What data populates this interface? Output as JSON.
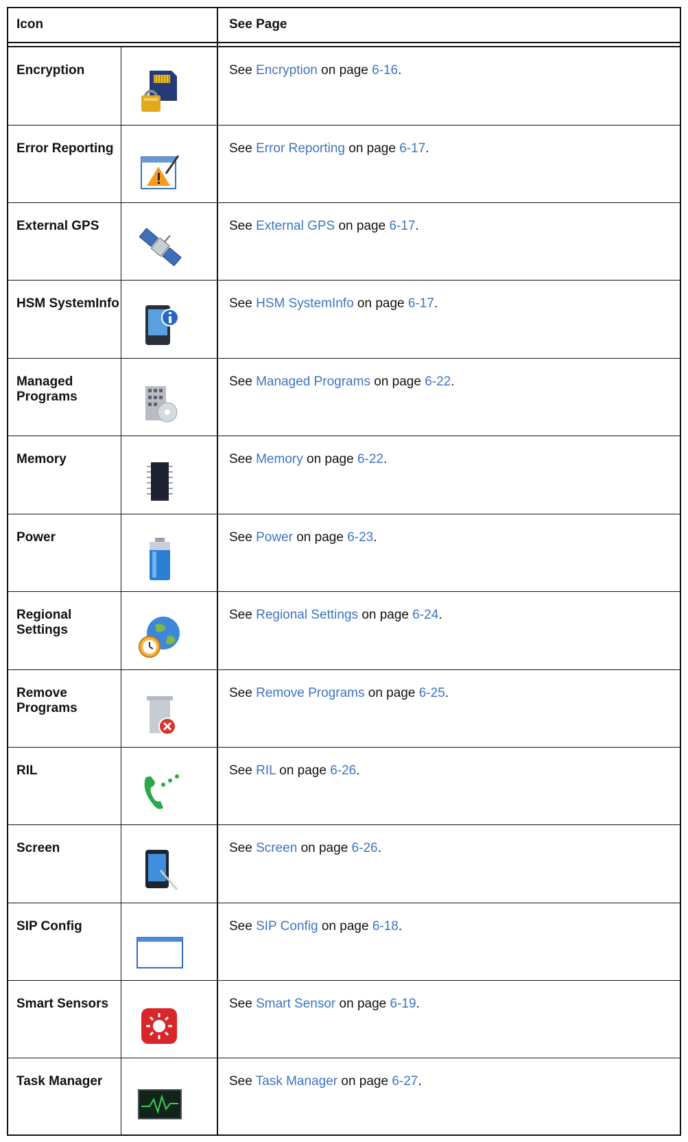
{
  "table": {
    "header": {
      "icon": "Icon",
      "see_page": "See Page"
    },
    "rows": [
      {
        "name": "Encryption",
        "icon": "sd-card-lock-icon",
        "see": "See",
        "link": "Encryption",
        "on_page": "on page",
        "page": "6-16",
        "end": "."
      },
      {
        "name": "Error Reporting",
        "icon": "error-report-icon",
        "see": "See",
        "link": "Error Reporting",
        "on_page": "on page",
        "page": "6-17",
        "end": "."
      },
      {
        "name": "External GPS",
        "icon": "satellite-icon",
        "see": "See",
        "link": "External GPS",
        "on_page": "on page",
        "page": "6-17",
        "end": "."
      },
      {
        "name": "HSM SystemInfo",
        "icon": "device-info-icon",
        "see": "See",
        "link": "HSM SystemInfo",
        "on_page": "on page",
        "page": "6-17",
        "end": "."
      },
      {
        "name": "Managed Programs",
        "icon": "building-disc-icon",
        "see": "See",
        "link": "Managed Programs",
        "on_page": "on page",
        "page": "6-22",
        "end": "."
      },
      {
        "name": "Memory",
        "icon": "memory-chip-icon",
        "see": "See",
        "link": "Memory",
        "on_page": "on page",
        "page": "6-22",
        "end": "."
      },
      {
        "name": "Power",
        "icon": "battery-icon",
        "see": "See",
        "link": "Power",
        "on_page": "on page",
        "page": "6-23",
        "end": "."
      },
      {
        "name": "Regional Settings",
        "icon": "globe-clock-icon",
        "see": "See",
        "link": "Regional Settings",
        "on_page": "on page",
        "page": "6-24",
        "end": "."
      },
      {
        "name": "Remove Programs",
        "icon": "trash-remove-icon",
        "see": "See",
        "link": "Remove Programs",
        "on_page": "on page",
        "page": "6-25",
        "end": "."
      },
      {
        "name": "RIL",
        "icon": "phone-signal-icon",
        "see": "See",
        "link": "RIL",
        "on_page": "on page",
        "page": "6-26",
        "end": "."
      },
      {
        "name": "Screen",
        "icon": "screen-stylus-icon",
        "see": "See",
        "link": "Screen",
        "on_page": "on page",
        "page": "6-26",
        "end": "."
      },
      {
        "name": "SIP Config",
        "icon": "window-icon",
        "see": "See",
        "link": "SIP Config",
        "on_page": "on page",
        "page": "6-18",
        "end": "."
      },
      {
        "name": "Smart Sensors",
        "icon": "smart-sensor-icon",
        "see": "See",
        "link": "Smart Sensor",
        "on_page": "on page",
        "page": "6-19",
        "end": "."
      },
      {
        "name": "Task Manager",
        "icon": "task-monitor-icon",
        "see": "See",
        "link": "Task Manager",
        "on_page": "on page",
        "page": "6-27",
        "end": "."
      }
    ]
  },
  "colors": {
    "link": "#3d74c2",
    "border": "#111111",
    "text": "#111111"
  }
}
